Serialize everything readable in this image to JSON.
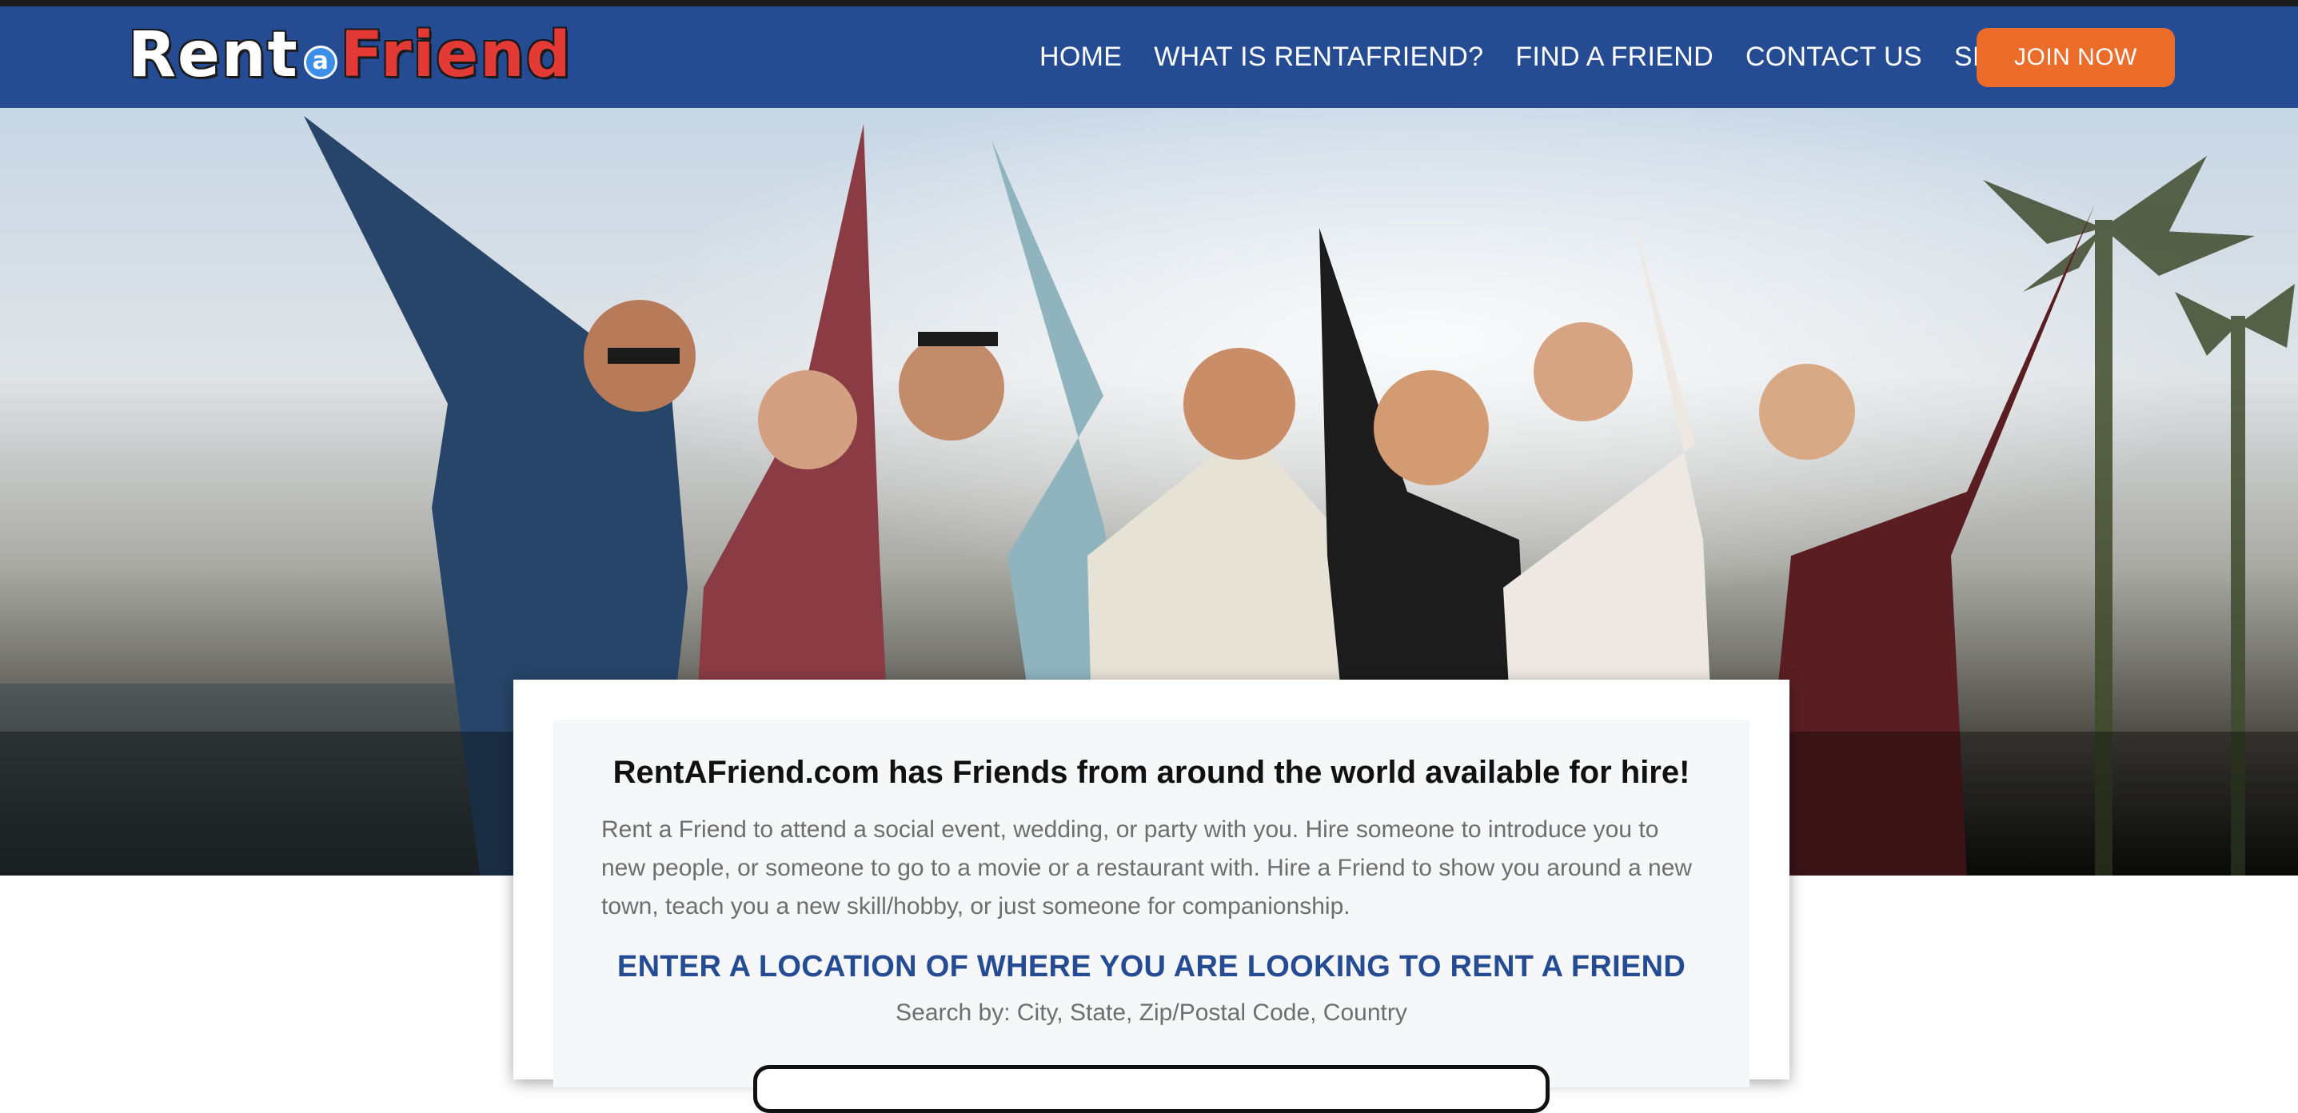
{
  "header": {
    "logo": {
      "part1": "Rent",
      "part2": "a",
      "part3": "Friend"
    },
    "nav": [
      {
        "label": "HOME"
      },
      {
        "label": "WHAT IS RENTAFRIEND?"
      },
      {
        "label": "FIND A FRIEND"
      },
      {
        "label": "CONTACT US"
      },
      {
        "label": "SIGN IN"
      }
    ],
    "join_label": "JOIN NOW"
  },
  "card": {
    "title": "RentAFriend.com has Friends from around the world available for hire!",
    "description": "Rent a Friend to attend a social event, wedding, or party with you. Hire someone to introduce you to new people, or someone to go to a movie or a restaurant with. Hire a Friend to show you around a new town, teach you a new skill/hobby, or just someone for companionship.",
    "cta": "ENTER A LOCATION OF WHERE YOU ARE LOOKING TO RENT A FRIEND",
    "hint": "Search by: City, State, Zip/Postal Code, Country"
  },
  "colors": {
    "header_bg": "#254b93",
    "join_button": "#ec6c2a",
    "cta_text": "#254b93",
    "logo_rent": "#ffffff",
    "logo_friend": "#e43a36",
    "logo_a_circle": "#3b8fe8"
  }
}
